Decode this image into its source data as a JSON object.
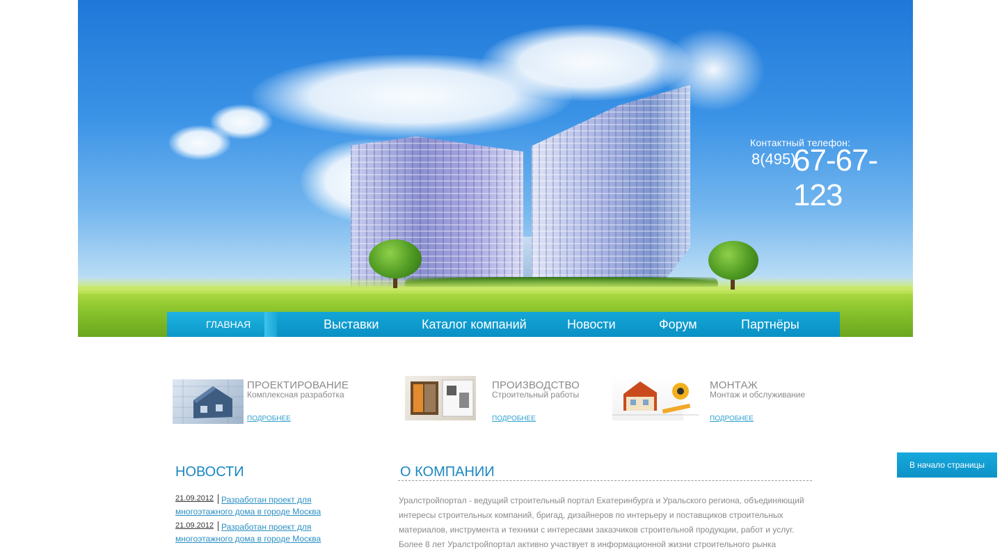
{
  "header": {
    "phone_label": "Контактный телефон:",
    "phone_code": "8(495)",
    "phone_number": "67-67-123"
  },
  "menu": {
    "items": [
      {
        "label": "ГЛАВНАЯ",
        "active": true
      },
      {
        "label": "Выставки"
      },
      {
        "label": "Каталог компаний"
      },
      {
        "label": "Новости"
      },
      {
        "label": "Форум"
      },
      {
        "label": "Партнёры"
      }
    ]
  },
  "services": [
    {
      "title": "ПРОЕКТИРОВАНИЕ",
      "subtitle": "Комплексная разработка",
      "more": "ПОДРОБНЕЕ",
      "icon": "house-blueprint-icon"
    },
    {
      "title": "ПРОИЗВОДСТВО",
      "subtitle": "Строительный работы",
      "more": "ПОДРОБНЕЕ",
      "icon": "construction-icon"
    },
    {
      "title": "МОНТАЖ",
      "subtitle": "Монтаж и обслуживание",
      "more": "ПОДРОБНЕЕ",
      "icon": "tools-icon"
    }
  ],
  "news": {
    "heading": "НОВОСТИ",
    "items": [
      {
        "date": "21.09.2012",
        "text": "Разработан проект для многоэтажного дома в городе Москва"
      },
      {
        "date": "21.09.2012",
        "text": "Разработан проект для многоэтажного дома в городе Москва"
      }
    ]
  },
  "about": {
    "heading": "О КОМПАНИИ",
    "text": "Уралстройпортал - ведущий строительный портал Екатеринбурга и Уральского региона, объединяющий интересы строительных компаний, бригад, дизайнеров по интерьеру и поставщиков строительных материалов, инструмента и техники с интересами заказчиков строительной продукции, работ и услуг. Более 8 лет Уралстройпортал активно участвует в информационной жизни строительного рынка"
  },
  "to_top": "В начало страницы",
  "colors": {
    "accent": "#1b87c2",
    "menu": "#0a90c4",
    "text_gray": "#8a8a8a",
    "link": "#2fa1cf"
  }
}
